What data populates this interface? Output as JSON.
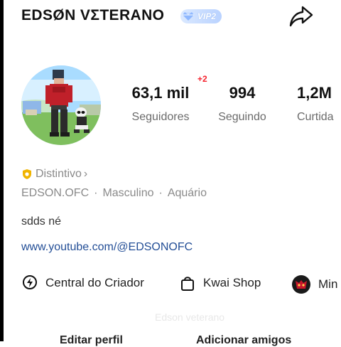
{
  "profile": {
    "name": "EDSØN VΣTERANO",
    "vip_label": "VIP2",
    "stats": [
      {
        "value": "63,1 mil",
        "label": "Seguidores"
      },
      {
        "value": "994",
        "label": "Seguindo"
      },
      {
        "value": "1,2M",
        "label": "Curtida"
      }
    ],
    "followers_delta": "+2",
    "badge_label": "Distintivo",
    "badge_chevron": "›",
    "meta": [
      "EDSON.OFC",
      "Masculino",
      "Aquário"
    ],
    "meta_separator": "·",
    "bio": "sdds né",
    "link": "www.youtube.com/@EDSONOFC"
  },
  "shortcuts": [
    {
      "label": "Central do Criador",
      "icon": "location-pin-icon"
    },
    {
      "label": "Kwai Shop",
      "icon": "shopping-bag-icon"
    },
    {
      "label": "Min",
      "icon": "mini-game-avatar-icon"
    }
  ],
  "watermark": "Edson veterano",
  "buttons": [
    "Editar perfil",
    "Adicionar amigos"
  ],
  "colors": {
    "delta_red": "#f5222d",
    "link_blue": "#234e96",
    "vip_blue": "#b9d2ff",
    "badge_gold": "#f0b400"
  }
}
